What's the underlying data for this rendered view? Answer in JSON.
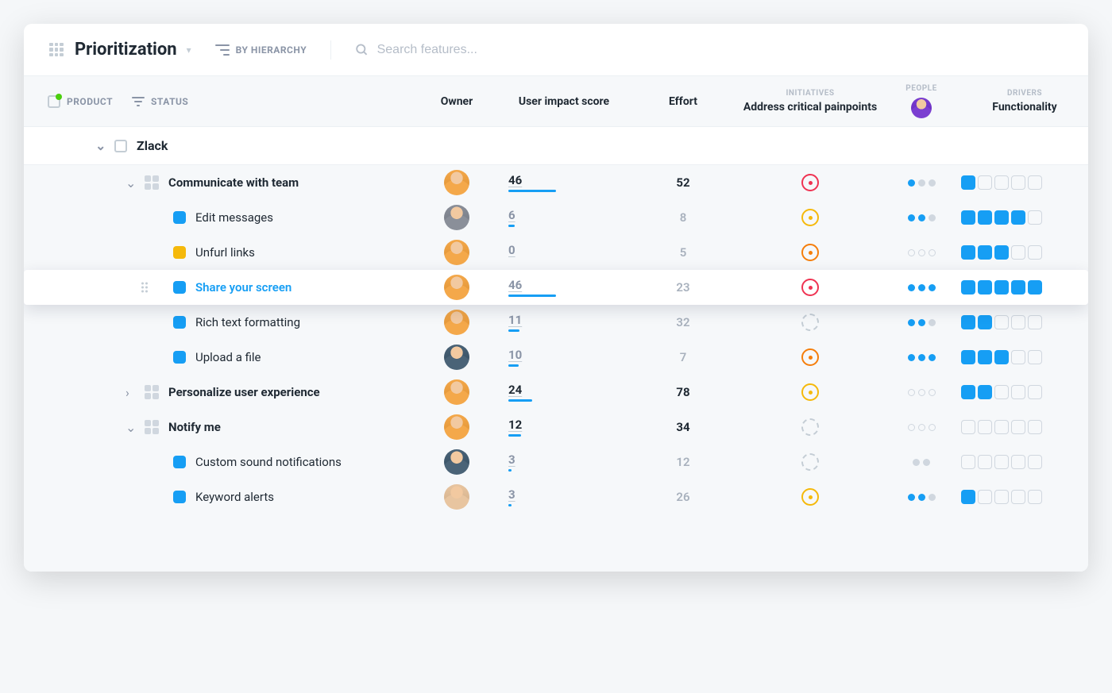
{
  "toolbar": {
    "view_title": "Prioritization",
    "hierarchy_label": "BY HIERARCHY",
    "search_placeholder": "Search features..."
  },
  "headers": {
    "product": "PRODUCT",
    "status": "STATUS",
    "owner": "Owner",
    "impact": "User impact score",
    "effort": "Effort",
    "initiatives_super": "INITIATIVES",
    "initiatives": "Address critical painpoints",
    "people_super": "PEOPLE",
    "drivers_super": "DRIVERS",
    "drivers": "Functionality"
  },
  "group": {
    "title": "Zlack"
  },
  "rows": [
    {
      "type": "parent",
      "depth": 1,
      "chev": "v",
      "title": "Communicate with team",
      "owner": "p1",
      "score": 46,
      "score_bar": 60,
      "effort": 52,
      "effort_bold": true,
      "initiative": "red",
      "people": [
        1,
        0,
        0
      ],
      "peopleMode": "dot",
      "drivers": [
        1,
        0,
        0,
        0,
        0
      ]
    },
    {
      "type": "child",
      "depth": 2,
      "color": "blue",
      "title": "Edit messages",
      "owner": "p2",
      "score": 6,
      "score_bar": 8,
      "effort": 8,
      "initiative": "amber",
      "people": [
        1,
        1,
        0
      ],
      "peopleMode": "dot",
      "drivers": [
        1,
        1,
        1,
        1,
        0
      ]
    },
    {
      "type": "child",
      "depth": 2,
      "color": "amber",
      "title": "Unfurl links",
      "owner": "p1",
      "score": 0,
      "score_bar": 0,
      "effort": 5,
      "initiative": "orange",
      "people": [
        0,
        0,
        0
      ],
      "peopleMode": "empty",
      "drivers": [
        1,
        1,
        1,
        0,
        0
      ]
    },
    {
      "type": "child",
      "depth": 2,
      "color": "blue",
      "title": "Share your screen",
      "owner": "p1",
      "highlighted": true,
      "score": 46,
      "score_bar": 60,
      "effort": 23,
      "initiative": "red",
      "people": [
        1,
        1,
        1
      ],
      "peopleMode": "dot",
      "drivers": [
        1,
        1,
        1,
        1,
        1
      ]
    },
    {
      "type": "child",
      "depth": 2,
      "color": "blue",
      "title": "Rich text formatting",
      "owner": "p1",
      "score": 11,
      "score_bar": 14,
      "effort": 32,
      "initiative": "dashed",
      "people": [
        1,
        1,
        0
      ],
      "peopleMode": "dot",
      "drivers": [
        1,
        1,
        0,
        0,
        0
      ]
    },
    {
      "type": "child",
      "depth": 2,
      "color": "blue",
      "title": "Upload a file",
      "owner": "p3",
      "score": 10,
      "score_bar": 13,
      "effort": 7,
      "initiative": "orange",
      "people": [
        1,
        1,
        1
      ],
      "peopleMode": "dot",
      "drivers": [
        1,
        1,
        1,
        0,
        0
      ]
    },
    {
      "type": "parent",
      "depth": 1,
      "chev": ">",
      "title": "Personalize user experience",
      "owner": "p1",
      "score": 24,
      "score_bar": 30,
      "effort": 78,
      "effort_bold": true,
      "initiative": "amber",
      "people": [
        0,
        0,
        0
      ],
      "peopleMode": "empty",
      "drivers": [
        1,
        1,
        0,
        0,
        0
      ]
    },
    {
      "type": "parent",
      "depth": 1,
      "chev": "v",
      "title": "Notify me",
      "owner": "p1",
      "score": 12,
      "score_bar": 16,
      "effort": 34,
      "effort_bold": true,
      "initiative": "dashed",
      "people": [
        0,
        0,
        0
      ],
      "peopleMode": "empty",
      "drivers": [
        0,
        0,
        0,
        0,
        0
      ]
    },
    {
      "type": "child",
      "depth": 2,
      "color": "blue",
      "title": "Custom sound notifications",
      "owner": "p3",
      "score": 3,
      "score_bar": 4,
      "effort": 12,
      "initiative": "dashed",
      "people": [
        0,
        1,
        1,
        0
      ],
      "peopleMode": "dotgrey",
      "drivers": [
        0,
        0,
        0,
        0,
        0
      ]
    },
    {
      "type": "child",
      "depth": 2,
      "color": "blue",
      "title": "Keyword alerts",
      "owner": "p4",
      "score": 3,
      "score_bar": 4,
      "effort": 26,
      "initiative": "amber",
      "people": [
        1,
        1,
        0
      ],
      "peopleMode": "dot",
      "drivers": [
        1,
        0,
        0,
        0,
        0
      ]
    }
  ],
  "owners": {
    "p1": {
      "bg": "#f4a84a"
    },
    "p2": {
      "bg": "#8a8f99"
    },
    "p3": {
      "bg": "#4a6377"
    },
    "p4": {
      "bg": "#e8c5a0"
    },
    "people_header": {
      "bg": "#7b3fd1"
    }
  }
}
